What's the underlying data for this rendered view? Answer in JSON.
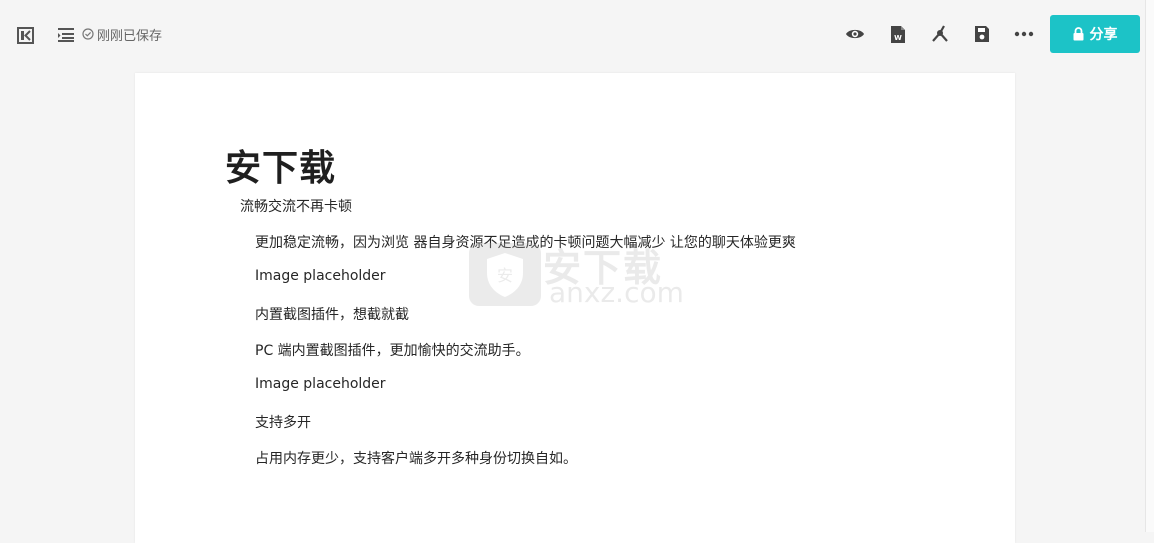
{
  "toolbar": {
    "save_status": "刚刚已保存",
    "share_label": "分享",
    "icons": {
      "collapse": "collapse-sidebar-icon",
      "outline": "outline-list-icon",
      "check": "check-circle-icon",
      "preview": "eye-icon",
      "export_word": "word-document-icon",
      "mindmap": "mindmap-icon",
      "save": "save-disk-icon",
      "more": "more-dots-icon",
      "lock": "lock-icon"
    }
  },
  "document": {
    "title": "安下载",
    "lines": [
      "流畅交流不再卡顿",
      "更加稳定流畅，因为浏览 器自身资源不足造成的卡顿问题大幅减少 让您的聊天体验更爽",
      "Image placeholder",
      "内置截图插件，想截就截",
      "PC 端内置截图插件，更加愉快的交流助手。",
      "Image placeholder",
      "支持多开",
      "占用内存更少，支持客户端多开多种身份切换自如。"
    ]
  },
  "watermark": {
    "text_cn": "安下载",
    "text_en": "anxz.com"
  },
  "colors": {
    "accent": "#1cc3c7",
    "page_bg": "#f5f5f5",
    "paper_bg": "#ffffff"
  }
}
